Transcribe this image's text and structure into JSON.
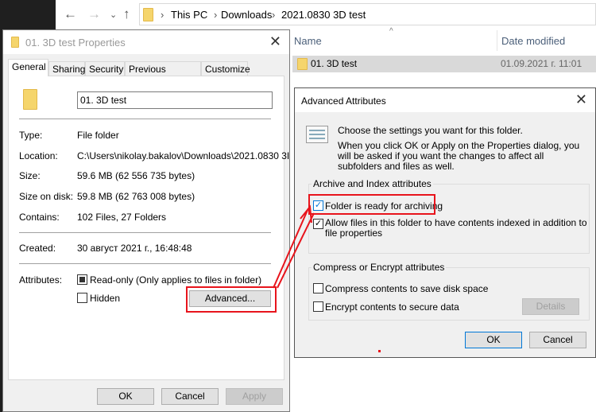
{
  "explorer": {
    "breadcrumb": [
      "This PC",
      "Downloads",
      "2021.0830 3D test"
    ],
    "columns": {
      "name": "Name",
      "date": "Date modified"
    },
    "row": {
      "name": "01. 3D test",
      "date": "01.09.2021 г. 11:01"
    }
  },
  "properties": {
    "title": "01. 3D test Properties",
    "tabs": [
      "General",
      "Sharing",
      "Security",
      "Previous Versions",
      "Customize"
    ],
    "name_value": "01. 3D test",
    "fields": [
      {
        "label": "Type:",
        "value": "File folder"
      },
      {
        "label": "Location:",
        "value": "C:\\Users\\nikolay.bakalov\\Downloads\\2021.0830 3I"
      },
      {
        "label": "Size:",
        "value": "59.6 MB (62 556 735 bytes)"
      },
      {
        "label": "Size on disk:",
        "value": "59.8 MB (62 763 008 bytes)"
      },
      {
        "label": "Contains:",
        "value": "102 Files, 27 Folders"
      }
    ],
    "created_label": "Created:",
    "created_value": "30 август 2021 г., 16:48:48",
    "attributes_label": "Attributes:",
    "readonly": {
      "label": "Read-only (Only applies to files in folder)",
      "state": "indeterminate"
    },
    "hidden": {
      "label": "Hidden",
      "checked": false
    },
    "advanced": "Advanced...",
    "ok": "OK",
    "cancel": "Cancel",
    "apply": "Apply"
  },
  "advanced": {
    "title": "Advanced Attributes",
    "intro": "Choose the settings you want for this folder.",
    "note": "When you click OK or Apply on the Properties dialog, you will be asked if you want the changes to affect all subfolders and files as well.",
    "group1": "Archive and Index attributes",
    "archive": {
      "label": "Folder is ready for archiving",
      "checked": true
    },
    "index": {
      "label": "Allow files in this folder to have contents indexed in addition to file properties",
      "checked": true
    },
    "group2": "Compress or Encrypt attributes",
    "compress": {
      "label": "Compress contents to save disk space",
      "checked": false
    },
    "encrypt": {
      "label": "Encrypt contents to secure data",
      "checked": false
    },
    "details": "Details",
    "ok": "OK",
    "cancel": "Cancel"
  },
  "colors": {
    "annotation": "#e8141c",
    "accent": "#0078d7"
  }
}
